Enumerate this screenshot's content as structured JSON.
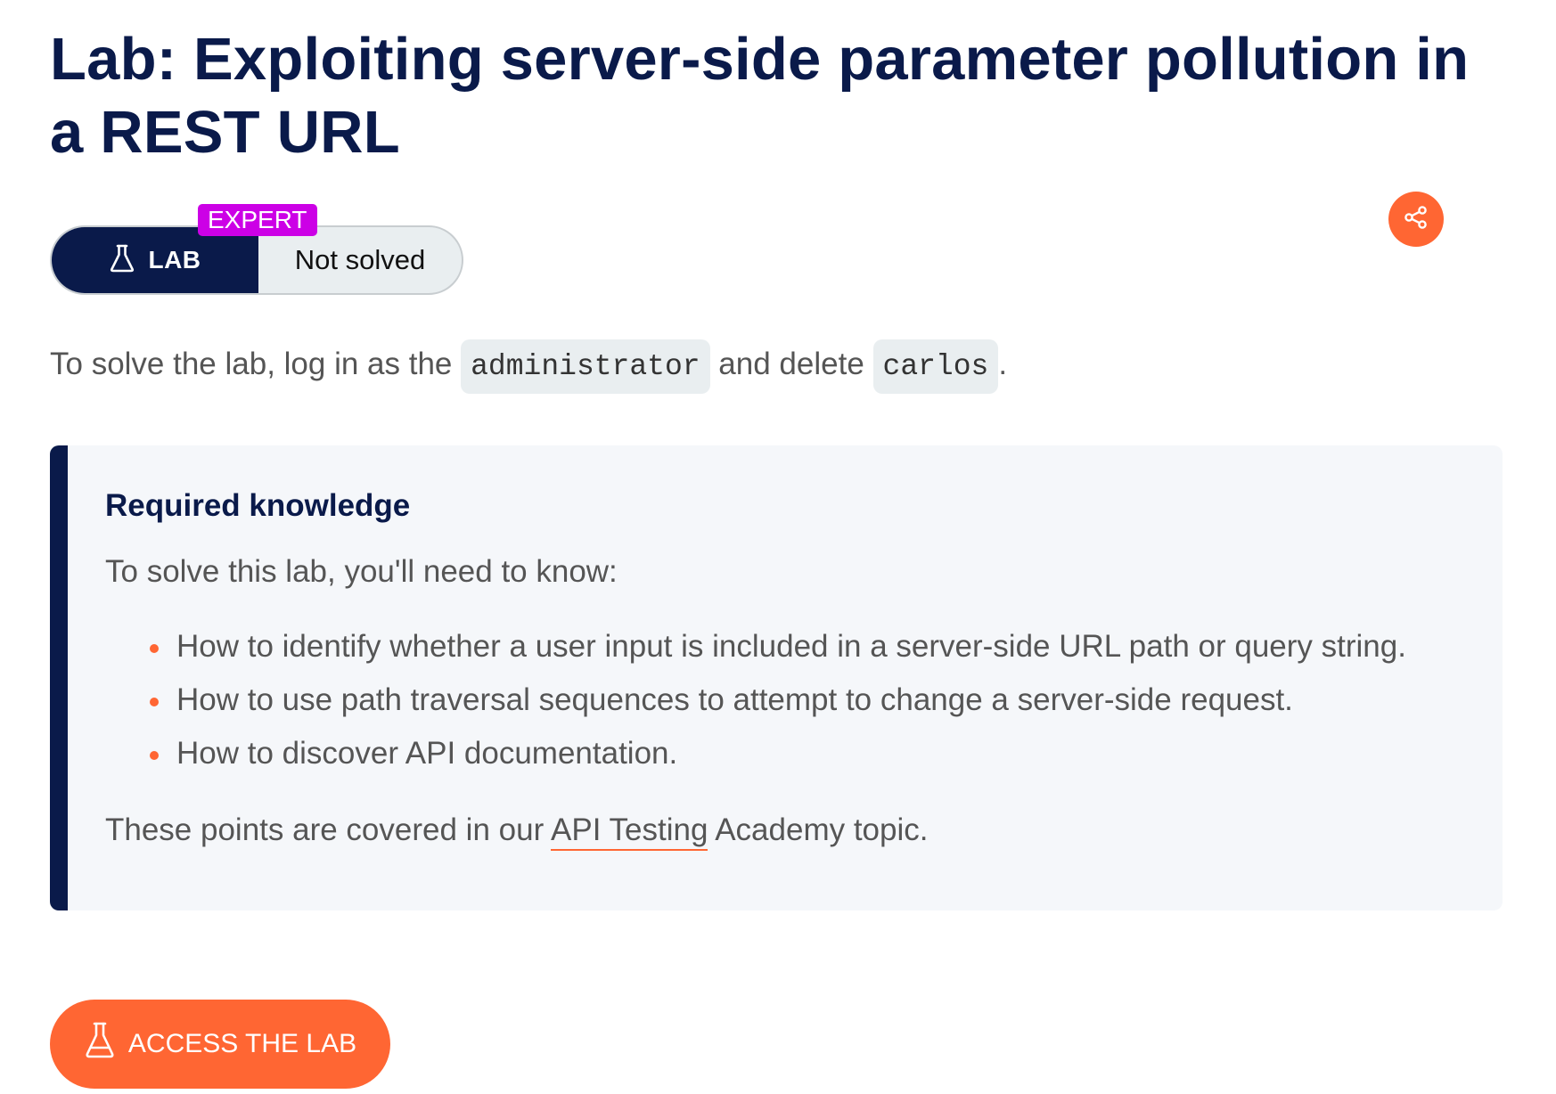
{
  "page": {
    "title": "Lab: Exploiting server-side parameter pollution in a REST URL"
  },
  "badge": {
    "level": "EXPERT",
    "type_label": "LAB",
    "status": "Not solved"
  },
  "share": {
    "icon": "share-icon",
    "color": "#ff6633"
  },
  "intro": {
    "prefix": "To solve the lab, log in as the ",
    "code_user": "administrator",
    "middle": " and delete ",
    "code_target": "carlos",
    "suffix": "."
  },
  "knowledge": {
    "heading": "Required knowledge",
    "lead": "To solve this lab, you'll need to know:",
    "items": [
      "How to identify whether a user input is included in a server-side URL path or query string.",
      "How to use path traversal sequences to attempt to change a server-side request.",
      "How to discover API documentation."
    ],
    "outro_prefix": "These points are covered in our ",
    "outro_link": "API Testing",
    "outro_suffix": " Academy topic."
  },
  "access_button": {
    "label": "ACCESS THE LAB",
    "icon": "flask-icon"
  },
  "colors": {
    "navy": "#0a1a4a",
    "accent": "#ff6633",
    "expert": "#cc00e6"
  }
}
